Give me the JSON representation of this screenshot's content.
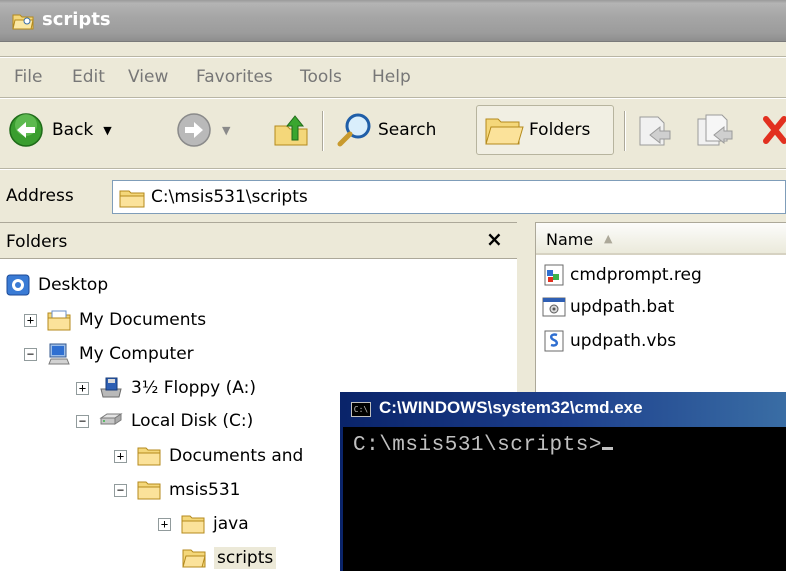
{
  "window": {
    "title": "scripts"
  },
  "menu": [
    "File",
    "Edit",
    "View",
    "Favorites",
    "Tools",
    "Help"
  ],
  "toolbar": {
    "back_label": "Back",
    "search_label": "Search",
    "folders_label": "Folders"
  },
  "address": {
    "label": "Address",
    "path": "C:\\msis531\\scripts"
  },
  "folders_pane": {
    "title": "Folders",
    "close_glyph": "×",
    "tree": [
      {
        "label": "Desktop",
        "icon": "desktop-icon"
      },
      {
        "label": "My Documents",
        "icon": "my-documents-icon",
        "expander": "+"
      },
      {
        "label": "My Computer",
        "icon": "my-computer-icon",
        "expander": "−"
      },
      {
        "label": "3½ Floppy (A:)",
        "icon": "floppy-drive-icon",
        "expander": "+"
      },
      {
        "label": "Local Disk (C:)",
        "icon": "hard-drive-icon",
        "expander": "−"
      },
      {
        "label": "Documents and",
        "icon": "folder-icon",
        "expander": "+"
      },
      {
        "label": "msis531",
        "icon": "folder-icon",
        "expander": "−"
      },
      {
        "label": "java",
        "icon": "folder-icon",
        "expander": "+"
      },
      {
        "label": "scripts",
        "icon": "open-folder-icon",
        "selected": true
      }
    ]
  },
  "files_pane": {
    "column_name": "Name",
    "sort_glyph": "▲",
    "files": [
      {
        "name": "cmdprompt.reg",
        "icon": "registry-file-icon"
      },
      {
        "name": "updpath.bat",
        "icon": "batch-file-icon"
      },
      {
        "name": "updpath.vbs",
        "icon": "vbscript-file-icon"
      }
    ]
  },
  "console": {
    "title": "C:\\WINDOWS\\system32\\cmd.exe",
    "icon_text": "C:\\",
    "prompt": "C:\\msis531\\scripts>"
  }
}
